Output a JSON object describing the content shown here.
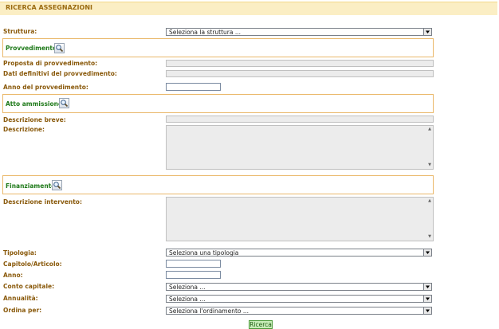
{
  "header": {
    "title": "RICERCA ASSEGNAZIONI"
  },
  "fields": {
    "struttura": {
      "label": "Struttura:",
      "value": "Seleziona la struttura ..."
    },
    "provvedimento_section": "Provvedimento",
    "proposta": {
      "label": "Proposta di provvedimento:",
      "value": ""
    },
    "dati_definitivi": {
      "label": "Dati definitivi del provvedimento:",
      "value": ""
    },
    "anno_provvedimento": {
      "label": "Anno del provvedimento:",
      "value": ""
    },
    "atto_section": "Atto ammissione",
    "descrizione_breve": {
      "label": "Descrizione breve:",
      "value": ""
    },
    "descrizione": {
      "label": "Descrizione:",
      "value": ""
    },
    "finanziamento_section": "Finanziamento",
    "descrizione_intervento": {
      "label": "Descrizione intervento:",
      "value": ""
    },
    "tipologia": {
      "label": "Tipologia:",
      "value": "Seleziona una tipologia"
    },
    "capitolo_articolo": {
      "label": "Capitolo/Articolo:",
      "value": ""
    },
    "anno": {
      "label": "Anno:",
      "value": ""
    },
    "conto_capitale": {
      "label": "Conto capitale:",
      "value": "Seleziona ..."
    },
    "annualita": {
      "label": "Annualità:",
      "value": "Seleziona ..."
    },
    "ordina_per": {
      "label": "Ordina per:",
      "value": "Seleziona l'ordinamento ..."
    }
  },
  "actions": {
    "search_label": "Ricerca"
  },
  "icons": {
    "section_lookup": "magnifier-icon",
    "dropdown": "chevron-down-icon"
  }
}
